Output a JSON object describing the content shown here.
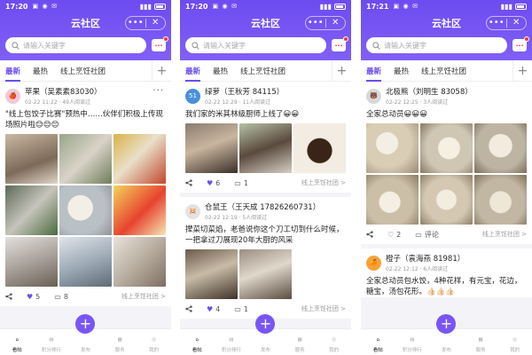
{
  "common": {
    "app_title": "云社区",
    "capsule_more": "•••",
    "capsule_close": "✕",
    "search_placeholder": "请输入关键字",
    "msg_icon_text": "···",
    "tabs": [
      "最新",
      "最热",
      "线上烹饪社团"
    ],
    "nav": [
      "看帖",
      "积分排行",
      "发布",
      "服务",
      "我的"
    ],
    "accent": "#6c4cf0"
  },
  "screens": [
    {
      "time": "17:20",
      "post": {
        "author": "苹果（吴素素83030）",
        "meta": "02-22 11:22 · 49人阅读过",
        "text": "\"线上包饺子比赛\"预热中……伙伴们积极上传现场照片啦😊😊😊",
        "likes": "5",
        "comments": "8",
        "group": "线上烹饪社团 >"
      }
    },
    {
      "time": "17:20",
      "posts": [
        {
          "author": "绿萝（王秋芳 84115）",
          "meta": "02-22 12:29 · 11人阅读过",
          "text": "我们家的米其林级厨师上线了😀😀",
          "likes": "6",
          "comments": "1",
          "group": "线上烹饪社团 >"
        },
        {
          "author": "仓鼠王（王天成 17826260731）",
          "meta": "02-22 12:19 · 5人阅读过",
          "text": "撵菜切菜焰，老爸说你这个刀工切到什么时候，一把拿过刀展现20年大厨的风采",
          "likes": "4",
          "comments": "1",
          "group": "线上烹饪社团 >"
        }
      ]
    },
    {
      "time": "17:21",
      "posts": [
        {
          "author": "北极熊（刘明生 83058）",
          "meta": "02-22 12:25 · 3人阅读过",
          "text": "全家总动员😀😀😀",
          "likes": "2",
          "comments": "评论",
          "group": "线上烹饪社团 >"
        },
        {
          "author": "橙子（袁海燕 81981）",
          "meta": "02-22 12:12 · 6人阅读过",
          "text": "全家总动员包水饺，4种花样，有元宝，花边，糖宝，汤包花形。👍🏻👍🏻👍🏻"
        }
      ]
    }
  ]
}
